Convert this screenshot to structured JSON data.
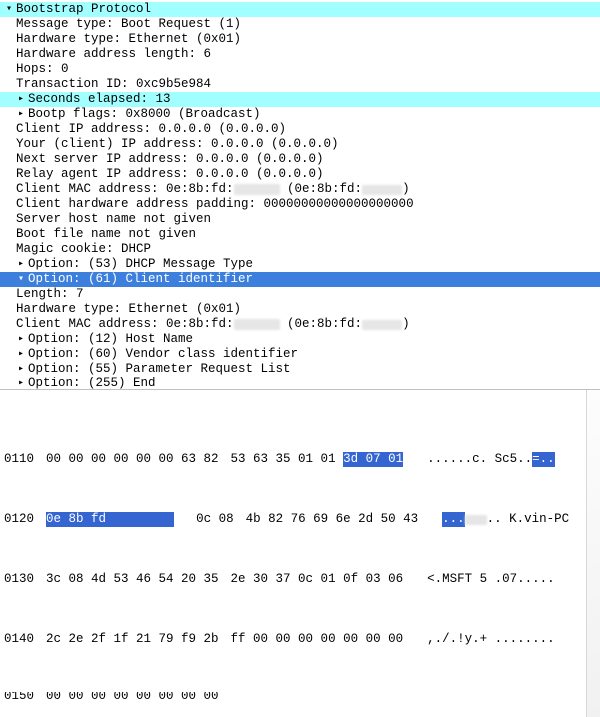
{
  "proto": {
    "title": "Bootstrap Protocol",
    "msg_type": "Message type: Boot Request (1)",
    "hw_type": "Hardware type: Ethernet (0x01)",
    "hw_addr_len": "Hardware address length: 6",
    "hops": "Hops: 0",
    "txn_id": "Transaction ID: 0xc9b5e984",
    "secs": "Seconds elapsed: 13",
    "flags": "Bootp flags: 0x8000 (Broadcast)",
    "ciaddr": "Client IP address: 0.0.0.0 (0.0.0.0)",
    "yiaddr": "Your (client) IP address: 0.0.0.0 (0.0.0.0)",
    "siaddr": "Next server IP address: 0.0.0.0 (0.0.0.0)",
    "giaddr": "Relay agent IP address: 0.0.0.0 (0.0.0.0)",
    "chaddr_pre": "Client MAC address: 0e:8b:fd:",
    "chaddr_post": " (0e:8b:fd:",
    "chaddr_close": ")",
    "padding": "Client hardware address padding: 00000000000000000000",
    "sname": "Server host name not given",
    "file": "Boot file name not given",
    "magic": "Magic cookie: DHCP",
    "opt53": "Option: (53) DHCP Message Type",
    "opt61": "Option: (61) Client identifier",
    "opt61_len": "Length: 7",
    "opt61_hw": "Hardware type: Ethernet (0x01)",
    "opt61_mac_pre": "Client MAC address: 0e:8b:fd:",
    "opt61_mac_post": " (0e:8b:fd:",
    "opt61_mac_close": ")",
    "opt12": "Option: (12) Host Name",
    "opt60": "Option: (60) Vendor class identifier",
    "opt55": "Option: (55) Parameter Request List",
    "opt255": "Option: (255) End"
  },
  "hex": {
    "lines": [
      {
        "off": "0110",
        "b1": "00 00 00 00 00 00 63 82",
        "b2": "53 63 35 01 01 ",
        "sel": "3d 07 01",
        "a1": "......c. Sc5..",
        "a2": ""
      },
      {
        "off": "0120",
        "sel1": "0e 8b fd         ",
        "b2": "0c 08",
        "b3": "4b 82 76 69 6e 2d 50 43",
        "a1": "",
        "a2": " K.vin-PC"
      },
      {
        "off": "0130",
        "b1": "3c 08 4d 53 46 54 20 35",
        "b2": "2e 30 37 0c 01 0f 03 06",
        "a": "<.MSFT 5 .07....."
      },
      {
        "off": "0140",
        "b1": "2c 2e 2f 1f 21 79 f9 2b",
        "b2": "ff 00 00 00 00 00 00 00",
        "a": ",./.!y.+ ........"
      }
    ]
  }
}
